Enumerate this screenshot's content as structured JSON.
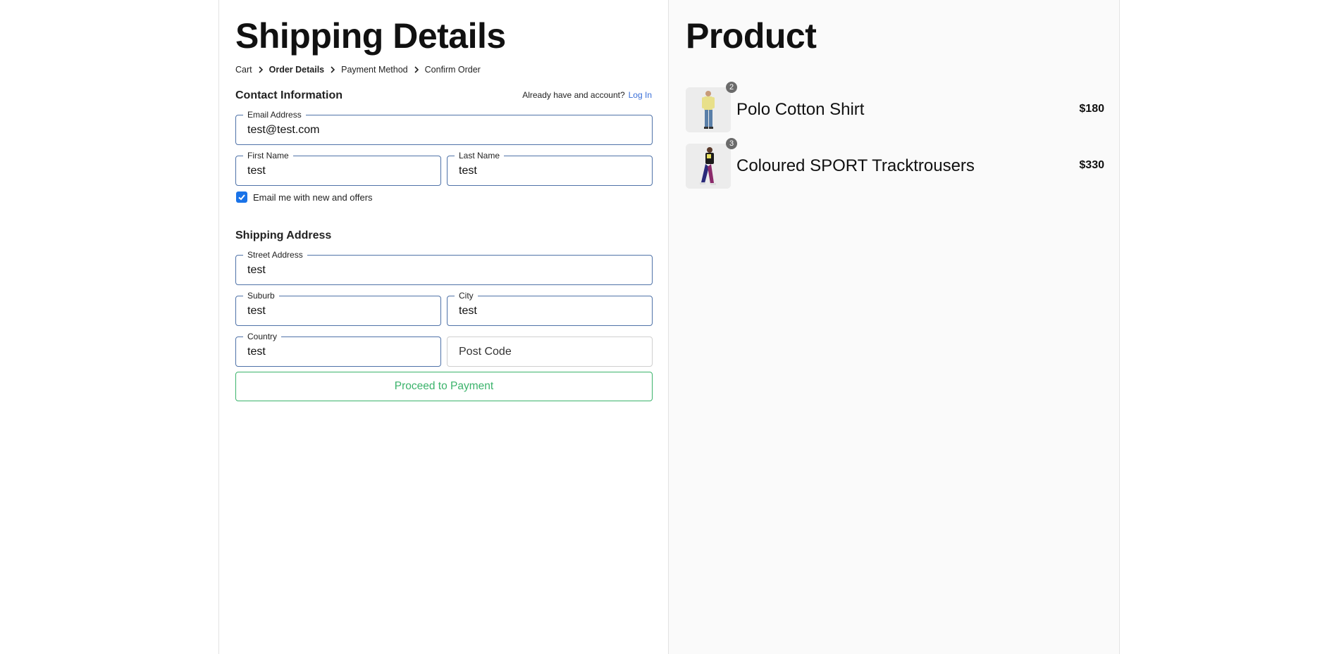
{
  "shipping": {
    "title": "Shipping Details",
    "breadcrumb": [
      "Cart",
      "Order Details",
      "Payment Method",
      "Confirm Order"
    ],
    "contact_heading": "Contact Information",
    "account_prompt": "Already have and account?",
    "login_link": "Log In",
    "email": {
      "label": "Email Address",
      "value": "test@test.com"
    },
    "first_name": {
      "label": "First Name",
      "value": "test"
    },
    "last_name": {
      "label": "Last Name",
      "value": "test"
    },
    "offers_checkbox": {
      "label": "Email me with new and offers",
      "checked": true
    },
    "address_heading": "Shipping Address",
    "street": {
      "label": "Street Address",
      "value": "test"
    },
    "suburb": {
      "label": "Suburb",
      "value": "test"
    },
    "city": {
      "label": "City",
      "value": "test"
    },
    "country": {
      "label": "Country",
      "value": "test"
    },
    "post_code": {
      "placeholder": "Post Code",
      "value": ""
    },
    "proceed_button": "Proceed to Payment"
  },
  "product": {
    "title": "Product",
    "items": [
      {
        "name": "Polo Cotton Shirt",
        "quantity": "2",
        "price": "$180"
      },
      {
        "name": "Coloured SPORT Tracktrousers",
        "quantity": "3",
        "price": "$330"
      }
    ]
  },
  "colors": {
    "accent_blue": "#4f72a8",
    "checkbox": "#1a73e8",
    "button_green": "#3bb36b",
    "link": "#3a6fd8"
  }
}
